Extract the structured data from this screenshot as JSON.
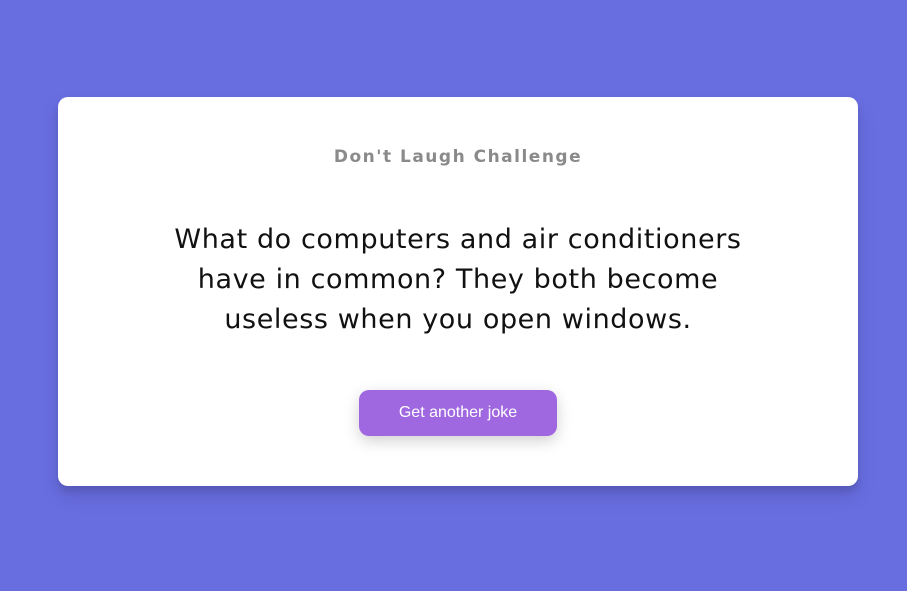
{
  "colors": {
    "background": "#686de0",
    "card": "#ffffff",
    "button": "#9f68e0",
    "title_text": "#8a8a8a"
  },
  "card": {
    "title": "Don't Laugh Challenge",
    "joke": "What do computers and air conditioners have in common? They both become useless when you open windows.",
    "button_label": "Get another joke"
  }
}
